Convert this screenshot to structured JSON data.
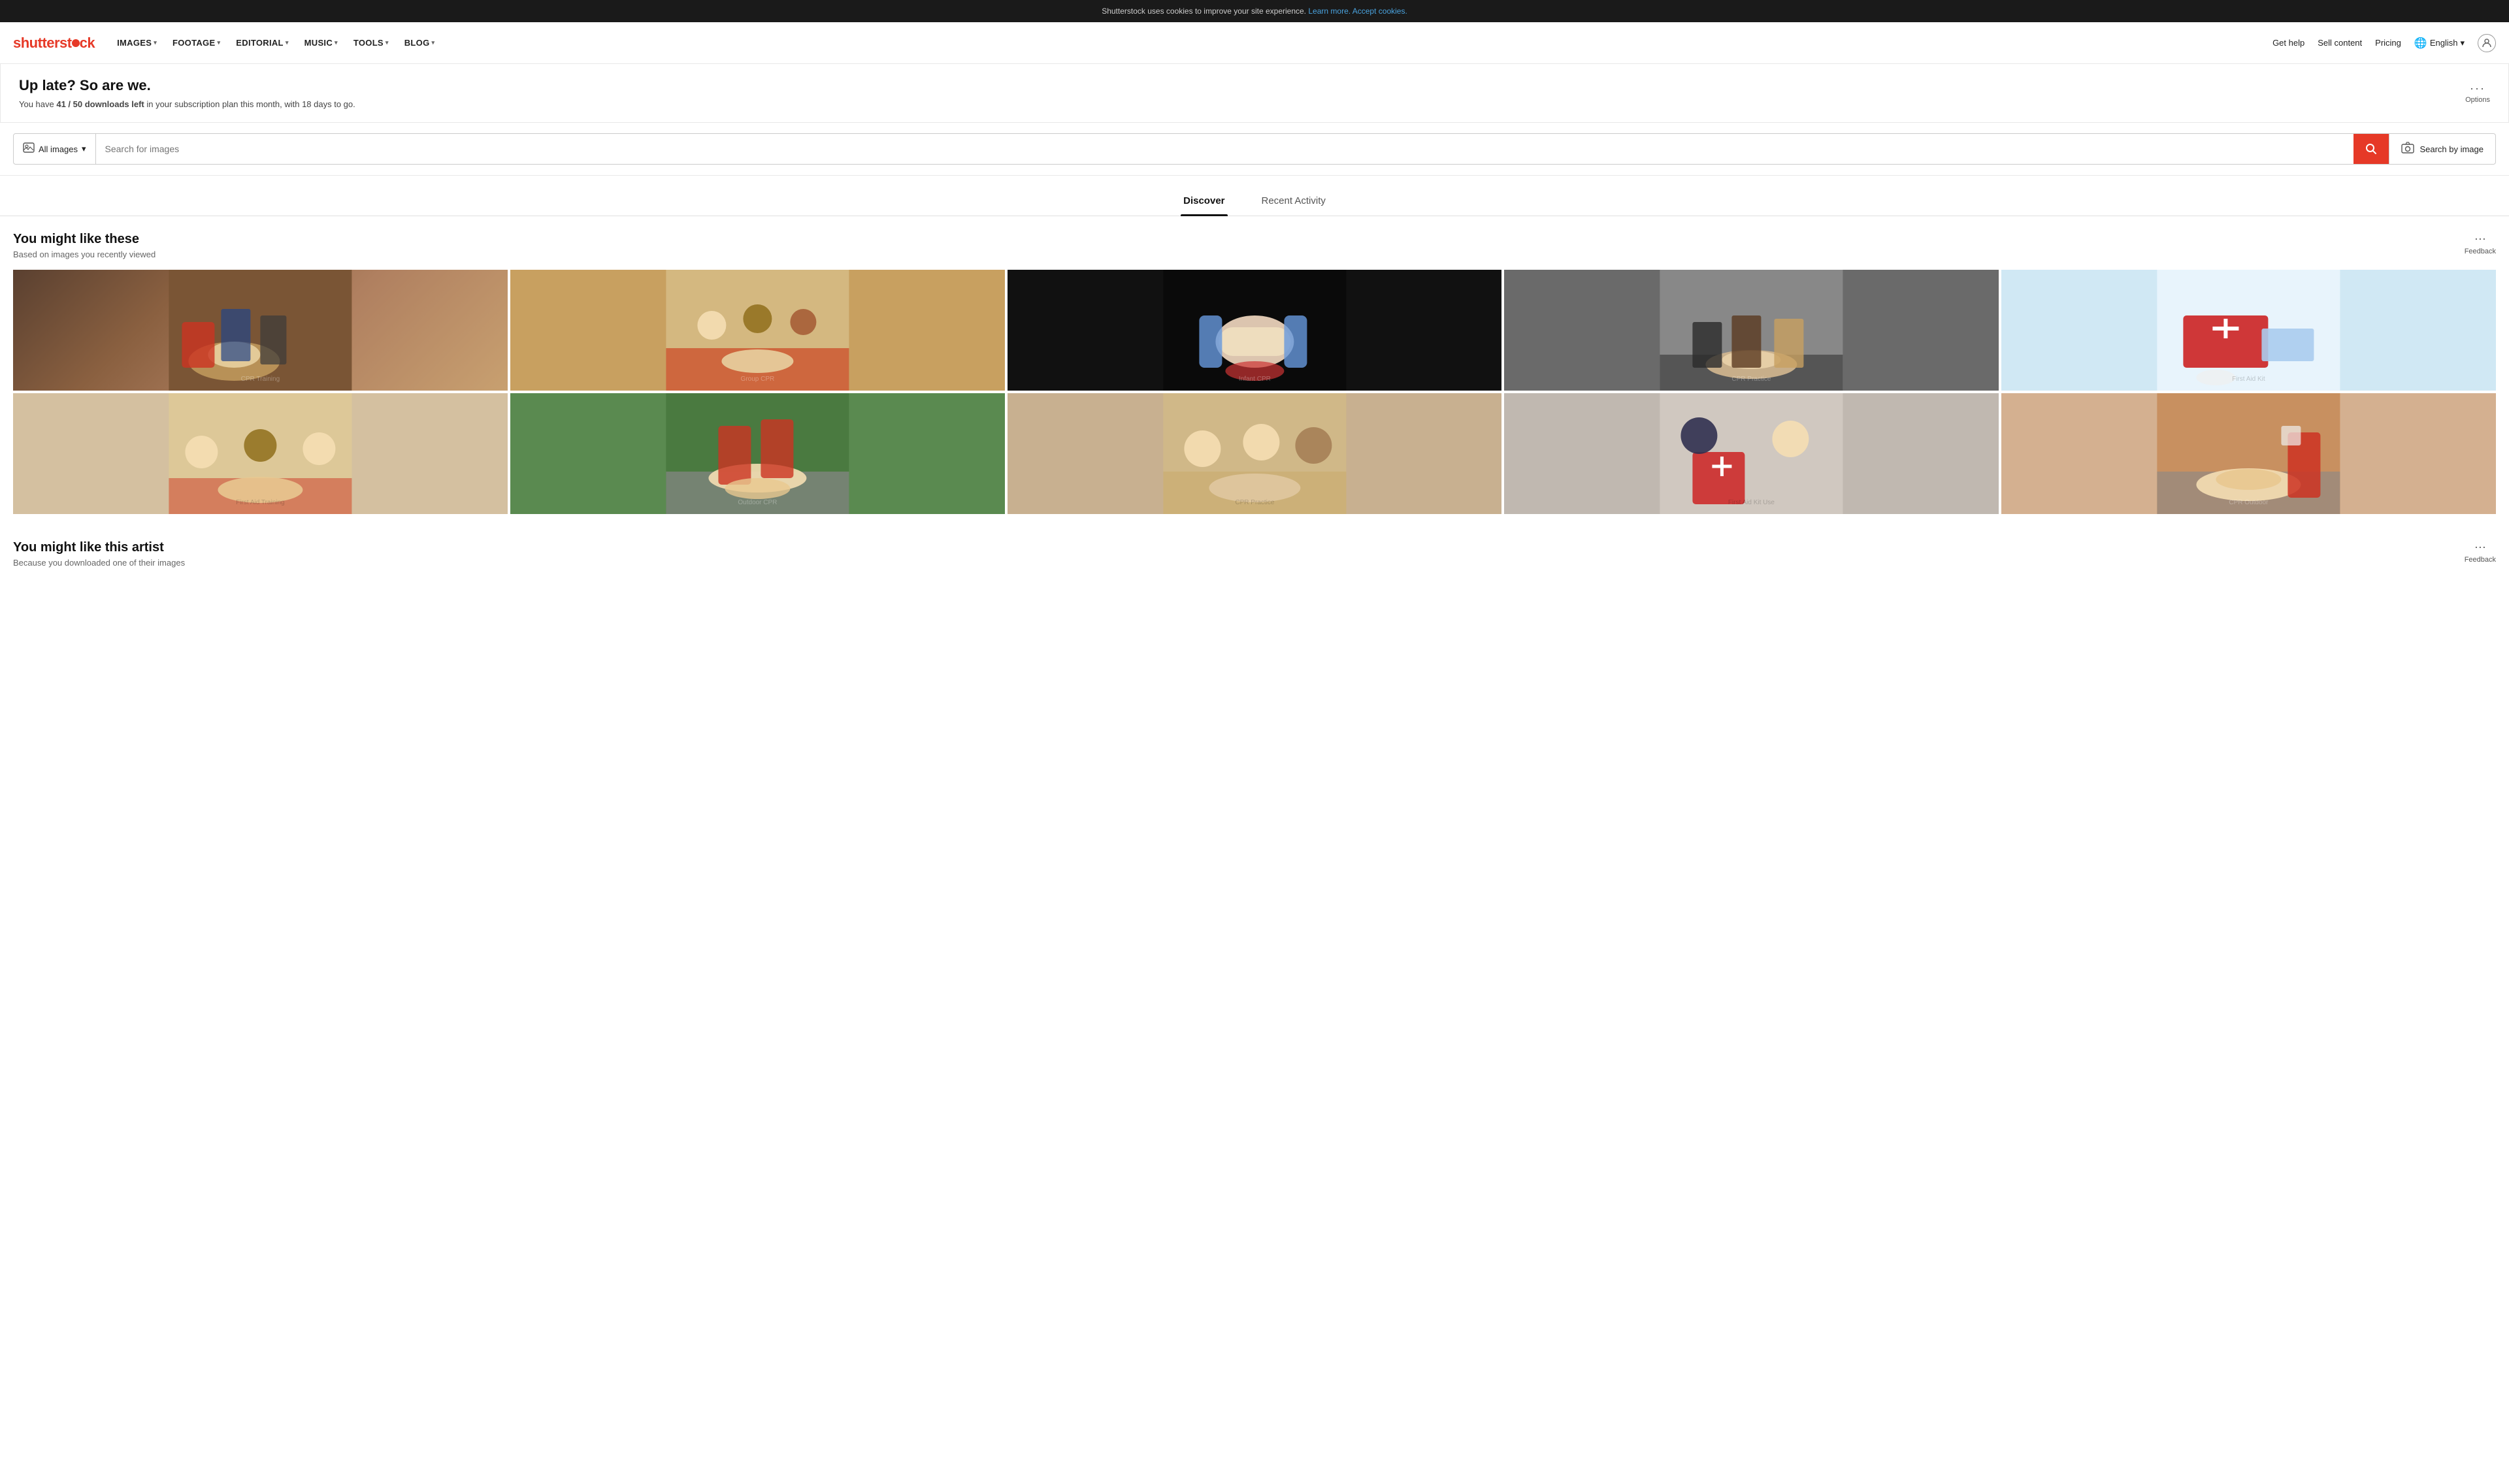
{
  "cookie_banner": {
    "text": "Shutterstock uses cookies to improve your site experience.",
    "learn_more": "Learn more.",
    "accept": "Accept cookies."
  },
  "header": {
    "logo": "shutterst●ck",
    "logo_brand": "shutterstock",
    "nav_items": [
      {
        "label": "IMAGES",
        "has_dropdown": true
      },
      {
        "label": "FOOTAGE",
        "has_dropdown": true
      },
      {
        "label": "EDITORIAL",
        "has_dropdown": true
      },
      {
        "label": "MUSIC",
        "has_dropdown": true
      },
      {
        "label": "TOOLS",
        "has_dropdown": true
      },
      {
        "label": "BLOG",
        "has_dropdown": true
      }
    ],
    "get_help": "Get help",
    "sell_content": "Sell content",
    "pricing": "Pricing",
    "language": "English",
    "user_icon": "person"
  },
  "promo": {
    "title": "Up late? So are we.",
    "description_pre": "You have ",
    "downloads": "41 / 50 downloads left",
    "description_post": " in your subscription plan this month, with 18 days to go.",
    "options_label": "Options",
    "options_dots": "···"
  },
  "search": {
    "category": "All images",
    "placeholder": "Search for images",
    "search_by_image": "Search by image"
  },
  "tabs": [
    {
      "label": "Discover",
      "active": true
    },
    {
      "label": "Recent Activity",
      "active": false
    }
  ],
  "section1": {
    "title": "You might like these",
    "subtitle": "Based on images you recently viewed",
    "feedback_dots": "···",
    "feedback_label": "Feedback"
  },
  "section2": {
    "title": "You might like this artist",
    "subtitle": "Because you downloaded one of their images",
    "feedback_dots": "···",
    "feedback_label": "Feedback"
  },
  "images_row1": [
    {
      "bg": "#8a6a4a",
      "desc": "CPR training on mannequin - people kneeling"
    },
    {
      "bg": "#c8a060",
      "desc": "CPR group training on red mat"
    },
    {
      "bg": "#1a1a1a",
      "desc": "Infant CPR demonstration with blue gloves"
    },
    {
      "bg": "#6a6a6a",
      "desc": "CPR practice - people around mannequin"
    },
    {
      "bg": "#d0e8f4",
      "desc": "First aid kit with scissors and supplies"
    }
  ],
  "images_row2": [
    {
      "bg": "#d4c0a0",
      "desc": "First aid training group session"
    },
    {
      "bg": "#5a8a50",
      "desc": "Outdoor CPR scene on ground"
    },
    {
      "bg": "#c8b090",
      "desc": "CPR practice - three people"
    },
    {
      "bg": "#c0b8b0",
      "desc": "First aid kit being used by two people"
    },
    {
      "bg": "#d4b090",
      "desc": "CPR on mannequin outdoors in red pants"
    }
  ]
}
